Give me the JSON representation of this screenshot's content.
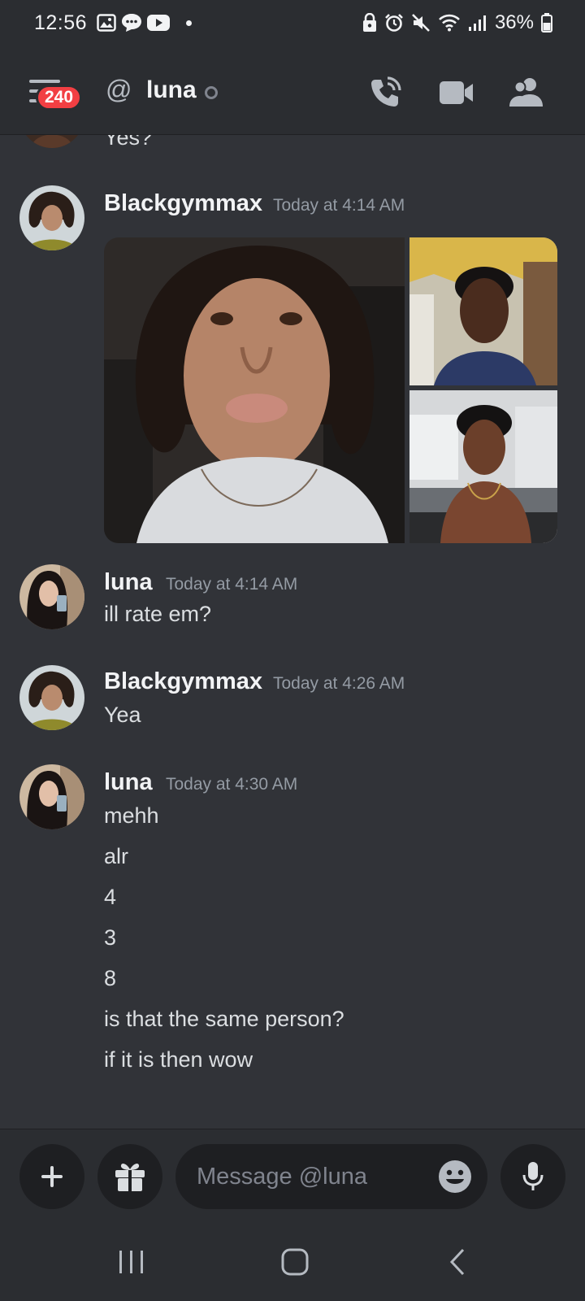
{
  "status_bar": {
    "time": "12:56",
    "battery": "36%",
    "left_icons": [
      "image-icon",
      "chat-bubble-icon",
      "youtube-icon"
    ],
    "right_icons": [
      "lock-icon",
      "alarm-icon",
      "mute-icon",
      "wifi-icon",
      "signal-icon",
      "battery-icon"
    ]
  },
  "header": {
    "notification_count": "240",
    "channel_name": "luna",
    "presence": "offline",
    "actions": [
      "voice-call-icon",
      "video-call-icon",
      "members-icon"
    ]
  },
  "messages": {
    "truncated_line": "Yes?",
    "m1": {
      "author": "Blackgymmax",
      "timestamp": "Today at 4:14 AM",
      "attachments": 3
    },
    "m2": {
      "author": "luna",
      "timestamp": "Today at 4:14 AM",
      "lines": [
        "ill rate em?"
      ]
    },
    "m3": {
      "author": "Blackgymmax",
      "timestamp": "Today at 4:26 AM",
      "lines": [
        "Yea"
      ]
    },
    "m4": {
      "author": "luna",
      "timestamp": "Today at 4:30 AM",
      "lines": [
        "mehh",
        "alr",
        "4",
        "3",
        "8",
        "is that the same person?",
        "if it is then wow"
      ]
    }
  },
  "composer": {
    "placeholder": "Message @luna",
    "buttons": [
      "plus-icon",
      "gift-icon",
      "emoji-icon",
      "microphone-icon"
    ]
  },
  "colors": {
    "background": "#313338",
    "header": "#2b2d31",
    "badge": "#f23f43",
    "input": "#1e1f22",
    "timestamp": "#949ba4"
  }
}
